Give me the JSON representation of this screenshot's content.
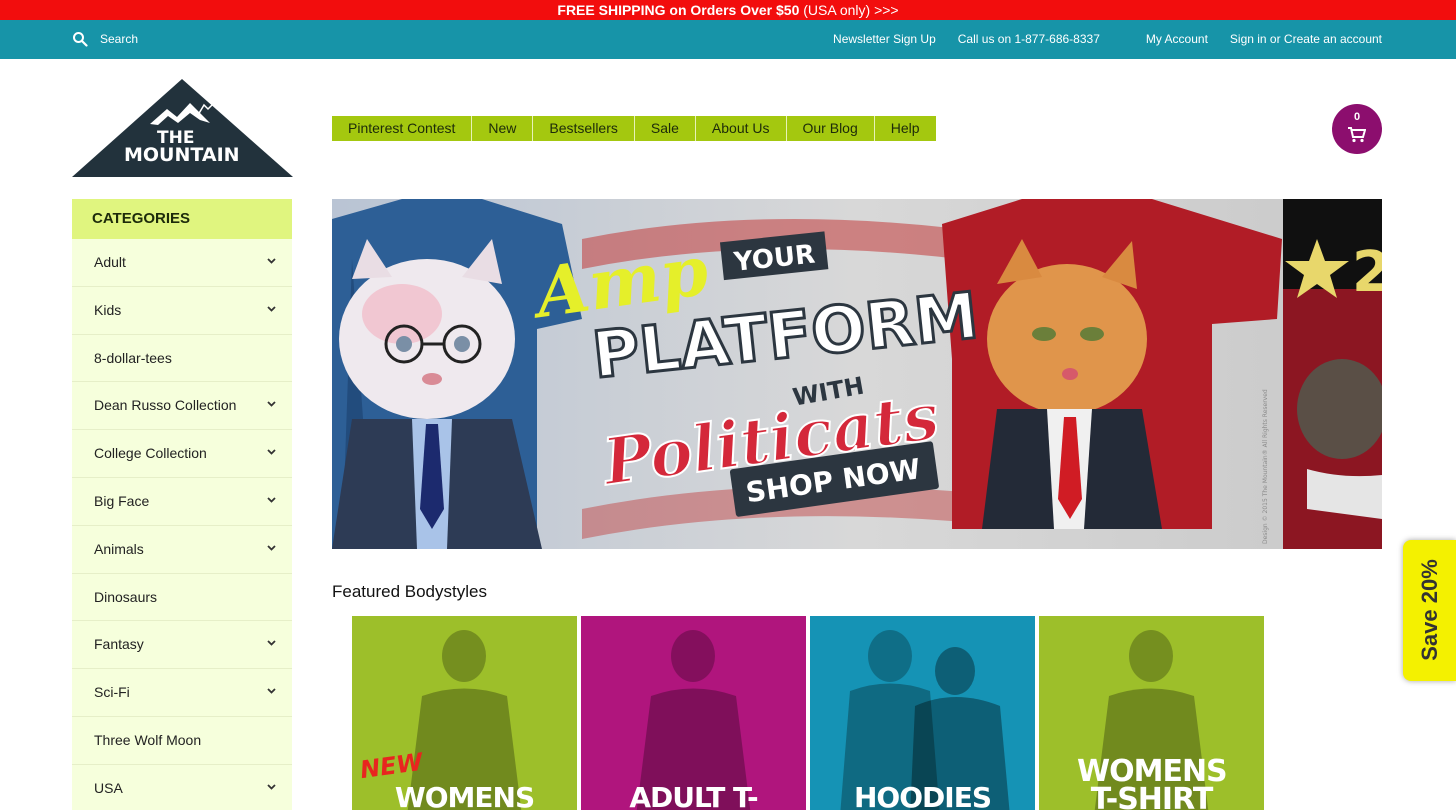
{
  "promo": {
    "bold": "FREE SHIPPING on Orders Over $50",
    "rest": " (USA only) >>>"
  },
  "topnav": {
    "search_label": "Search",
    "newsletter": "Newsletter Sign Up",
    "phone": "Call us on 1-877-686-8337",
    "account": "My Account",
    "signin": "Sign in or Create an account"
  },
  "logo": {
    "line1": "THE",
    "line2": "MOUNTAIN"
  },
  "mainnav": [
    "Pinterest Contest",
    "New",
    "Bestsellers",
    "Sale",
    "About Us",
    "Our Blog",
    "Help"
  ],
  "cart": {
    "count": "0"
  },
  "sidebar": {
    "heading": "CATEGORIES",
    "items": [
      {
        "label": "Adult",
        "expand": true
      },
      {
        "label": "Kids",
        "expand": true
      },
      {
        "label": "8-dollar-tees",
        "expand": false
      },
      {
        "label": "Dean Russo Collection",
        "expand": true
      },
      {
        "label": "College Collection",
        "expand": true
      },
      {
        "label": "Big Face",
        "expand": true
      },
      {
        "label": "Animals",
        "expand": true
      },
      {
        "label": "Dinosaurs",
        "expand": false
      },
      {
        "label": "Fantasy",
        "expand": true
      },
      {
        "label": "Sci-Fi",
        "expand": true
      },
      {
        "label": "Three Wolf Moon",
        "expand": false
      },
      {
        "label": "USA",
        "expand": true
      }
    ]
  },
  "hero": {
    "amp": "Amp",
    "your": "YOUR",
    "platform": "PLATFORM",
    "with": "WITH",
    "politicats": "Politicats",
    "shop_now": "SHOP NOW",
    "copyright": "Design © 2015 The Mountain® All Rights Reserved"
  },
  "featured": {
    "title": "Featured Bodystyles",
    "tiles": [
      {
        "label": "WOMENS FLOW",
        "badge": "NEW",
        "color": "#9dbf2a"
      },
      {
        "label": "ADULT T-SHIRTS",
        "badge": "",
        "color": "#b0157d"
      },
      {
        "label": "HOODIES",
        "badge": "",
        "color": "#1593b5"
      },
      {
        "label": "WOMENS T-SHIRT",
        "badge": "",
        "color": "#9dbf2a"
      }
    ]
  },
  "savetab": {
    "label": "Save 20%"
  },
  "colors": {
    "promo": "#f20d0d",
    "topnav": "#1794a8",
    "nav": "#a4c80f",
    "cart": "#8c0e6e",
    "sidebar_head": "#e0f57f",
    "sidebar_bg": "#f6ffdc",
    "save": "#f4f100"
  }
}
